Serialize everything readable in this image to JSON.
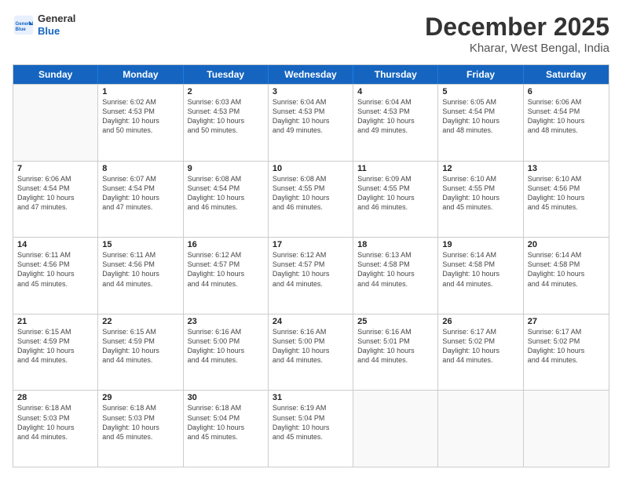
{
  "logo": {
    "general": "General",
    "blue": "Blue"
  },
  "header": {
    "month": "December 2025",
    "location": "Kharar, West Bengal, India"
  },
  "days_of_week": [
    "Sunday",
    "Monday",
    "Tuesday",
    "Wednesday",
    "Thursday",
    "Friday",
    "Saturday"
  ],
  "weeks": [
    [
      {
        "day": "",
        "empty": true
      },
      {
        "day": "1",
        "sunrise": "6:02 AM",
        "sunset": "4:53 PM",
        "daylight": "10 hours and 50 minutes."
      },
      {
        "day": "2",
        "sunrise": "6:03 AM",
        "sunset": "4:53 PM",
        "daylight": "10 hours and 50 minutes."
      },
      {
        "day": "3",
        "sunrise": "6:04 AM",
        "sunset": "4:53 PM",
        "daylight": "10 hours and 49 minutes."
      },
      {
        "day": "4",
        "sunrise": "6:04 AM",
        "sunset": "4:53 PM",
        "daylight": "10 hours and 49 minutes."
      },
      {
        "day": "5",
        "sunrise": "6:05 AM",
        "sunset": "4:54 PM",
        "daylight": "10 hours and 48 minutes."
      },
      {
        "day": "6",
        "sunrise": "6:06 AM",
        "sunset": "4:54 PM",
        "daylight": "10 hours and 48 minutes."
      }
    ],
    [
      {
        "day": "7",
        "sunrise": "6:06 AM",
        "sunset": "4:54 PM",
        "daylight": "10 hours and 47 minutes."
      },
      {
        "day": "8",
        "sunrise": "6:07 AM",
        "sunset": "4:54 PM",
        "daylight": "10 hours and 47 minutes."
      },
      {
        "day": "9",
        "sunrise": "6:08 AM",
        "sunset": "4:54 PM",
        "daylight": "10 hours and 46 minutes."
      },
      {
        "day": "10",
        "sunrise": "6:08 AM",
        "sunset": "4:55 PM",
        "daylight": "10 hours and 46 minutes."
      },
      {
        "day": "11",
        "sunrise": "6:09 AM",
        "sunset": "4:55 PM",
        "daylight": "10 hours and 46 minutes."
      },
      {
        "day": "12",
        "sunrise": "6:10 AM",
        "sunset": "4:55 PM",
        "daylight": "10 hours and 45 minutes."
      },
      {
        "day": "13",
        "sunrise": "6:10 AM",
        "sunset": "4:56 PM",
        "daylight": "10 hours and 45 minutes."
      }
    ],
    [
      {
        "day": "14",
        "sunrise": "6:11 AM",
        "sunset": "4:56 PM",
        "daylight": "10 hours and 45 minutes."
      },
      {
        "day": "15",
        "sunrise": "6:11 AM",
        "sunset": "4:56 PM",
        "daylight": "10 hours and 44 minutes."
      },
      {
        "day": "16",
        "sunrise": "6:12 AM",
        "sunset": "4:57 PM",
        "daylight": "10 hours and 44 minutes."
      },
      {
        "day": "17",
        "sunrise": "6:12 AM",
        "sunset": "4:57 PM",
        "daylight": "10 hours and 44 minutes."
      },
      {
        "day": "18",
        "sunrise": "6:13 AM",
        "sunset": "4:58 PM",
        "daylight": "10 hours and 44 minutes."
      },
      {
        "day": "19",
        "sunrise": "6:14 AM",
        "sunset": "4:58 PM",
        "daylight": "10 hours and 44 minutes."
      },
      {
        "day": "20",
        "sunrise": "6:14 AM",
        "sunset": "4:58 PM",
        "daylight": "10 hours and 44 minutes."
      }
    ],
    [
      {
        "day": "21",
        "sunrise": "6:15 AM",
        "sunset": "4:59 PM",
        "daylight": "10 hours and 44 minutes."
      },
      {
        "day": "22",
        "sunrise": "6:15 AM",
        "sunset": "4:59 PM",
        "daylight": "10 hours and 44 minutes."
      },
      {
        "day": "23",
        "sunrise": "6:16 AM",
        "sunset": "5:00 PM",
        "daylight": "10 hours and 44 minutes."
      },
      {
        "day": "24",
        "sunrise": "6:16 AM",
        "sunset": "5:00 PM",
        "daylight": "10 hours and 44 minutes."
      },
      {
        "day": "25",
        "sunrise": "6:16 AM",
        "sunset": "5:01 PM",
        "daylight": "10 hours and 44 minutes."
      },
      {
        "day": "26",
        "sunrise": "6:17 AM",
        "sunset": "5:02 PM",
        "daylight": "10 hours and 44 minutes."
      },
      {
        "day": "27",
        "sunrise": "6:17 AM",
        "sunset": "5:02 PM",
        "daylight": "10 hours and 44 minutes."
      }
    ],
    [
      {
        "day": "28",
        "sunrise": "6:18 AM",
        "sunset": "5:03 PM",
        "daylight": "10 hours and 44 minutes."
      },
      {
        "day": "29",
        "sunrise": "6:18 AM",
        "sunset": "5:03 PM",
        "daylight": "10 hours and 45 minutes."
      },
      {
        "day": "30",
        "sunrise": "6:18 AM",
        "sunset": "5:04 PM",
        "daylight": "10 hours and 45 minutes."
      },
      {
        "day": "31",
        "sunrise": "6:19 AM",
        "sunset": "5:04 PM",
        "daylight": "10 hours and 45 minutes."
      },
      {
        "day": "",
        "empty": true
      },
      {
        "day": "",
        "empty": true
      },
      {
        "day": "",
        "empty": true
      }
    ]
  ],
  "labels": {
    "sunrise": "Sunrise:",
    "sunset": "Sunset:",
    "daylight": "Daylight:"
  }
}
